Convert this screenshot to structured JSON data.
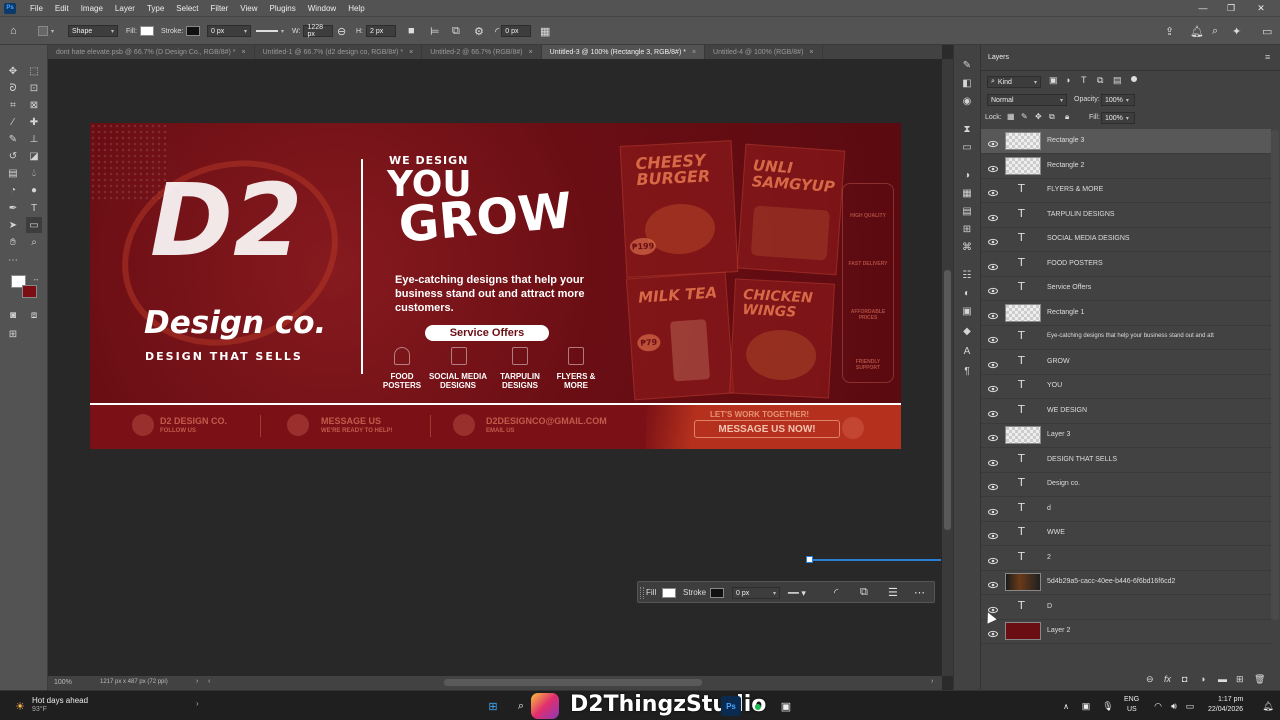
{
  "app": {
    "logo": "Ps"
  },
  "menu": [
    "File",
    "Edit",
    "Image",
    "Layer",
    "Type",
    "Select",
    "Filter",
    "View",
    "Plugins",
    "Window",
    "Help"
  ],
  "options_bar": {
    "tool_mode": "Shape",
    "fill_label": "Fill:",
    "stroke_label": "Stroke:",
    "stroke_width": "0 px",
    "w_label": "W:",
    "w_value": "1228 px",
    "h_label": "H:",
    "h_value": "2 px",
    "radius_value": "0 px"
  },
  "tabs": [
    {
      "label": "dont hate elevate.psb @ 66.7% (D  Design Co., RGB/8#) *",
      "active": false
    },
    {
      "label": "Untitled-1 @ 66.7% (d2 design co, RGB/8#) *",
      "active": false
    },
    {
      "label": "Untitled-2 @ 66.7% (RGB/8#)",
      "active": false
    },
    {
      "label": "Untitled-3 @ 100% (Rectangle 3, RGB/8#) *",
      "active": true
    },
    {
      "label": "Untitled-4 @ 100% (RGB/8#)",
      "active": false
    }
  ],
  "banner": {
    "logo_d2": "D2",
    "brand": "Design co.",
    "tagline": "DESIGN THAT SELLS",
    "we_design": "WE DESIGN",
    "you": "YOU",
    "grow": "GROW",
    "body": "Eye-catching designs that help your business stand out and attract more customers.",
    "cta": "Service Offers",
    "services": [
      {
        "label": "FOOD POSTERS"
      },
      {
        "label": "SOCIAL MEDIA DESIGNS"
      },
      {
        "label": "TARPULIN DESIGNS"
      },
      {
        "label": "FLYERS & MORE"
      }
    ],
    "posters": {
      "cheesy": "CHEESY BURGER",
      "unli": "UNLI SAMGYUP",
      "milktea": "MILK TEA",
      "chicken": "CHICKEN WINGS",
      "price1": "₱199",
      "price2": "₱79"
    },
    "features": [
      "HIGH QUALITY",
      "FAST DELIVERY",
      "AFFORDABLE PRICES",
      "FRIENDLY SUPPORT"
    ],
    "footer": {
      "fb": "D2 DESIGN CO.",
      "fb_sub": "FOLLOW US",
      "msg": "MESSAGE US",
      "msg_sub": "WE'RE READY TO HELP!",
      "email": "D2DESIGNCO@GMAIL.COM",
      "email_sub": "EMAIL US",
      "lets": "LET'S WORK TOGETHER!",
      "cta": "MESSAGE US NOW!"
    }
  },
  "prop_bar": {
    "fill": "Fill",
    "stroke": "Stroke",
    "stroke_value": "0 px"
  },
  "status": {
    "zoom": "100%",
    "info": "1217 px x 487 px (72 ppi)"
  },
  "layers_panel": {
    "title": "Layers",
    "filter_kind": "Kind",
    "blend_mode": "Normal",
    "opacity_label": "Opacity:",
    "opacity": "100%",
    "lock_label": "Lock:",
    "fill_label": "Fill:",
    "fill": "100%",
    "layers": [
      {
        "name": "Rectangle 3",
        "type": "shape",
        "selected": true
      },
      {
        "name": "Rectangle 2",
        "type": "shape"
      },
      {
        "name": "FLYERS & MORE",
        "type": "text"
      },
      {
        "name": "TARPULIN DESIGNS",
        "type": "text"
      },
      {
        "name": "SOCIAL MEDIA DESIGNS",
        "type": "text"
      },
      {
        "name": "FOOD POSTERS",
        "type": "text"
      },
      {
        "name": "Service Offers",
        "type": "text"
      },
      {
        "name": "Rectangle 1",
        "type": "shape"
      },
      {
        "name": "Eye-catching designs that help your business stand out and att",
        "type": "text"
      },
      {
        "name": "GROW",
        "type": "text"
      },
      {
        "name": "YOU",
        "type": "text"
      },
      {
        "name": "WE DESIGN",
        "type": "text"
      },
      {
        "name": "Layer 3",
        "type": "pixel"
      },
      {
        "name": "DESIGN THAT SELLS",
        "type": "text"
      },
      {
        "name": "Design co.",
        "type": "text"
      },
      {
        "name": "d",
        "type": "text"
      },
      {
        "name": "WWE",
        "type": "text"
      },
      {
        "name": "2",
        "type": "text"
      },
      {
        "name": "5d4b29a5-cacc-40ee-b446-6f6bd16f6cd2",
        "type": "image"
      },
      {
        "name": "D",
        "type": "text"
      },
      {
        "name": "Layer 2",
        "type": "fill"
      }
    ]
  },
  "taskbar": {
    "weather_title": "Hot days ahead",
    "weather_temp": "93°F",
    "watermark": "D2ThingzStudio",
    "lang1": "ENG",
    "lang2": "US",
    "time": "1:17 pm",
    "date": "22/04/2026"
  },
  "colors": {
    "banner_bg": "#6a0e14",
    "accent": "#b5311d",
    "selection": "#2a7fd4"
  }
}
